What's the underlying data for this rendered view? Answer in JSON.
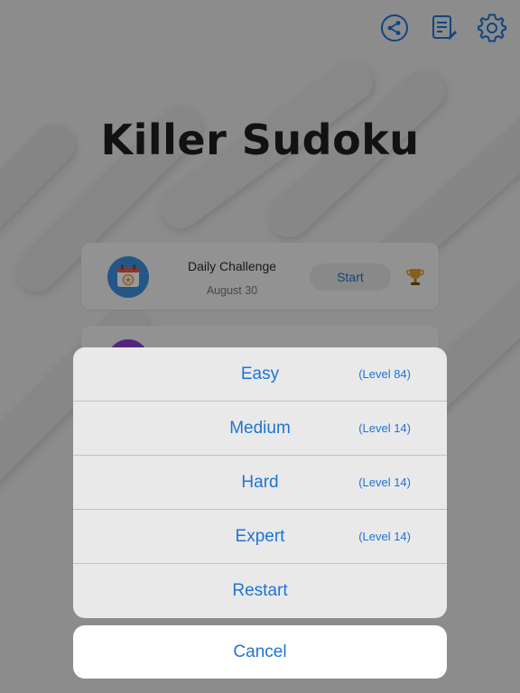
{
  "header": {
    "title": "Killer Sudoku",
    "icons": [
      "share-icon",
      "notes-icon",
      "gear-icon"
    ]
  },
  "daily": {
    "title": "Daily Challenge",
    "date": "August 30",
    "start_label": "Start"
  },
  "sheet": {
    "rows": [
      {
        "label": "Easy",
        "level": "(Level 84)"
      },
      {
        "label": "Medium",
        "level": "(Level 14)"
      },
      {
        "label": "Hard",
        "level": "(Level 14)"
      },
      {
        "label": "Expert",
        "level": "(Level 14)"
      },
      {
        "label": "Restart",
        "level": ""
      }
    ],
    "cancel_label": "Cancel"
  },
  "colors": {
    "accent": "#1f73d6",
    "background": "#e9e9e9",
    "title": "#1e1e1e"
  }
}
